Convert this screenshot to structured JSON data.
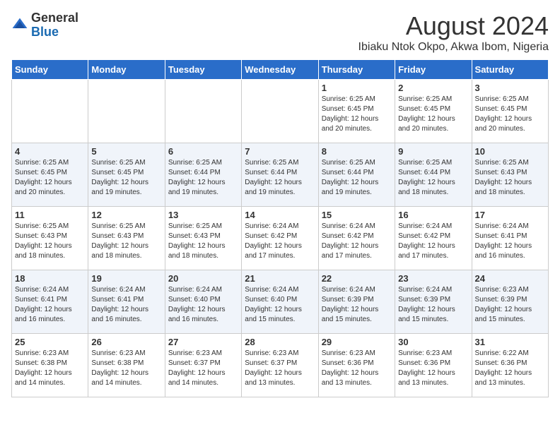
{
  "header": {
    "logo_general": "General",
    "logo_blue": "Blue",
    "month_year": "August 2024",
    "location": "Ibiaku Ntok Okpo, Akwa Ibom, Nigeria"
  },
  "days_of_week": [
    "Sunday",
    "Monday",
    "Tuesday",
    "Wednesday",
    "Thursday",
    "Friday",
    "Saturday"
  ],
  "weeks": [
    [
      {
        "day": "",
        "info": ""
      },
      {
        "day": "",
        "info": ""
      },
      {
        "day": "",
        "info": ""
      },
      {
        "day": "",
        "info": ""
      },
      {
        "day": "1",
        "info": "Sunrise: 6:25 AM\nSunset: 6:45 PM\nDaylight: 12 hours\nand 20 minutes."
      },
      {
        "day": "2",
        "info": "Sunrise: 6:25 AM\nSunset: 6:45 PM\nDaylight: 12 hours\nand 20 minutes."
      },
      {
        "day": "3",
        "info": "Sunrise: 6:25 AM\nSunset: 6:45 PM\nDaylight: 12 hours\nand 20 minutes."
      }
    ],
    [
      {
        "day": "4",
        "info": "Sunrise: 6:25 AM\nSunset: 6:45 PM\nDaylight: 12 hours\nand 20 minutes."
      },
      {
        "day": "5",
        "info": "Sunrise: 6:25 AM\nSunset: 6:45 PM\nDaylight: 12 hours\nand 19 minutes."
      },
      {
        "day": "6",
        "info": "Sunrise: 6:25 AM\nSunset: 6:44 PM\nDaylight: 12 hours\nand 19 minutes."
      },
      {
        "day": "7",
        "info": "Sunrise: 6:25 AM\nSunset: 6:44 PM\nDaylight: 12 hours\nand 19 minutes."
      },
      {
        "day": "8",
        "info": "Sunrise: 6:25 AM\nSunset: 6:44 PM\nDaylight: 12 hours\nand 19 minutes."
      },
      {
        "day": "9",
        "info": "Sunrise: 6:25 AM\nSunset: 6:44 PM\nDaylight: 12 hours\nand 18 minutes."
      },
      {
        "day": "10",
        "info": "Sunrise: 6:25 AM\nSunset: 6:43 PM\nDaylight: 12 hours\nand 18 minutes."
      }
    ],
    [
      {
        "day": "11",
        "info": "Sunrise: 6:25 AM\nSunset: 6:43 PM\nDaylight: 12 hours\nand 18 minutes."
      },
      {
        "day": "12",
        "info": "Sunrise: 6:25 AM\nSunset: 6:43 PM\nDaylight: 12 hours\nand 18 minutes."
      },
      {
        "day": "13",
        "info": "Sunrise: 6:25 AM\nSunset: 6:43 PM\nDaylight: 12 hours\nand 18 minutes."
      },
      {
        "day": "14",
        "info": "Sunrise: 6:24 AM\nSunset: 6:42 PM\nDaylight: 12 hours\nand 17 minutes."
      },
      {
        "day": "15",
        "info": "Sunrise: 6:24 AM\nSunset: 6:42 PM\nDaylight: 12 hours\nand 17 minutes."
      },
      {
        "day": "16",
        "info": "Sunrise: 6:24 AM\nSunset: 6:42 PM\nDaylight: 12 hours\nand 17 minutes."
      },
      {
        "day": "17",
        "info": "Sunrise: 6:24 AM\nSunset: 6:41 PM\nDaylight: 12 hours\nand 16 minutes."
      }
    ],
    [
      {
        "day": "18",
        "info": "Sunrise: 6:24 AM\nSunset: 6:41 PM\nDaylight: 12 hours\nand 16 minutes."
      },
      {
        "day": "19",
        "info": "Sunrise: 6:24 AM\nSunset: 6:41 PM\nDaylight: 12 hours\nand 16 minutes."
      },
      {
        "day": "20",
        "info": "Sunrise: 6:24 AM\nSunset: 6:40 PM\nDaylight: 12 hours\nand 16 minutes."
      },
      {
        "day": "21",
        "info": "Sunrise: 6:24 AM\nSunset: 6:40 PM\nDaylight: 12 hours\nand 15 minutes."
      },
      {
        "day": "22",
        "info": "Sunrise: 6:24 AM\nSunset: 6:39 PM\nDaylight: 12 hours\nand 15 minutes."
      },
      {
        "day": "23",
        "info": "Sunrise: 6:24 AM\nSunset: 6:39 PM\nDaylight: 12 hours\nand 15 minutes."
      },
      {
        "day": "24",
        "info": "Sunrise: 6:23 AM\nSunset: 6:39 PM\nDaylight: 12 hours\nand 15 minutes."
      }
    ],
    [
      {
        "day": "25",
        "info": "Sunrise: 6:23 AM\nSunset: 6:38 PM\nDaylight: 12 hours\nand 14 minutes."
      },
      {
        "day": "26",
        "info": "Sunrise: 6:23 AM\nSunset: 6:38 PM\nDaylight: 12 hours\nand 14 minutes."
      },
      {
        "day": "27",
        "info": "Sunrise: 6:23 AM\nSunset: 6:37 PM\nDaylight: 12 hours\nand 14 minutes."
      },
      {
        "day": "28",
        "info": "Sunrise: 6:23 AM\nSunset: 6:37 PM\nDaylight: 12 hours\nand 13 minutes."
      },
      {
        "day": "29",
        "info": "Sunrise: 6:23 AM\nSunset: 6:36 PM\nDaylight: 12 hours\nand 13 minutes."
      },
      {
        "day": "30",
        "info": "Sunrise: 6:23 AM\nSunset: 6:36 PM\nDaylight: 12 hours\nand 13 minutes."
      },
      {
        "day": "31",
        "info": "Sunrise: 6:22 AM\nSunset: 6:36 PM\nDaylight: 12 hours\nand 13 minutes."
      }
    ]
  ]
}
